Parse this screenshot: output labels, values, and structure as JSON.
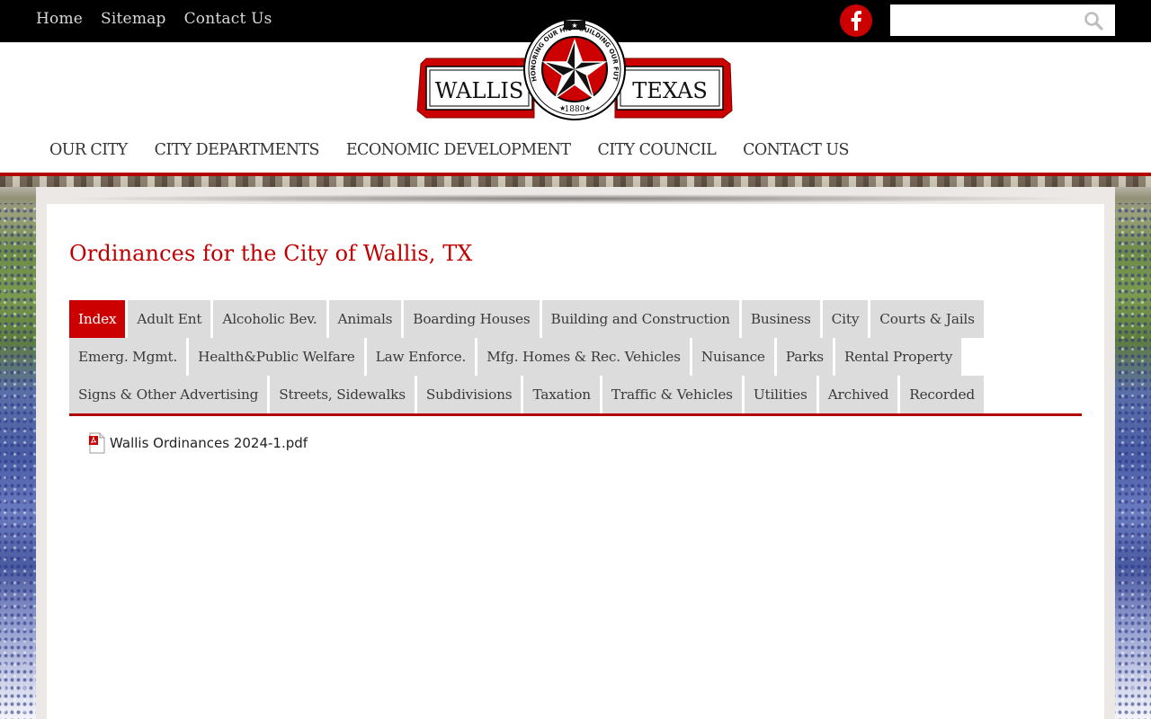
{
  "topbar": {
    "links": [
      "Home",
      "Sitemap",
      "Contact Us"
    ],
    "social_icon": "facebook-icon",
    "search": {
      "value": "",
      "placeholder": "",
      "icon": "search-icon"
    }
  },
  "logo": {
    "left_word": "WALLIS",
    "right_word": "TEXAS",
    "seal_top_left": "HONORING OUR HISTORY",
    "seal_top_right": "BUILDING OUR FUTURE",
    "seal_year": "1880",
    "colors": {
      "red": "#cc0000",
      "black": "#111111"
    }
  },
  "main_nav": [
    "OUR CITY",
    "CITY DEPARTMENTS",
    "ECONOMIC DEVELOPMENT",
    "CITY COUNCIL",
    "CONTACT US"
  ],
  "page": {
    "title": "Ordinances for the City of Wallis, TX"
  },
  "tabs": {
    "active_index": 0,
    "items": [
      "Index",
      "Adult Ent",
      "Alcoholic Bev.",
      "Animals",
      "Boarding Houses",
      "Building and Construction",
      "Business",
      "City",
      "Courts & Jails",
      "Emerg. Mgmt.",
      "Health&Public Welfare",
      "Law Enforce.",
      "Mfg. Homes & Rec. Vehicles",
      "Nuisance",
      "Parks",
      "Rental Property",
      "Signs & Other Advertising",
      "Streets, Sidewalks",
      "Subdivisions",
      "Taxation",
      "Traffic & Vehicles",
      "Utilities",
      "Archived",
      "Recorded"
    ]
  },
  "files": [
    {
      "name": "Wallis Ordinances 2024-1.pdf",
      "icon": "pdf-icon"
    }
  ],
  "colors": {
    "accent": "#cc0000",
    "rule": "#b30000",
    "tab_bg": "#dcdcdc",
    "topbar": "#000000"
  }
}
